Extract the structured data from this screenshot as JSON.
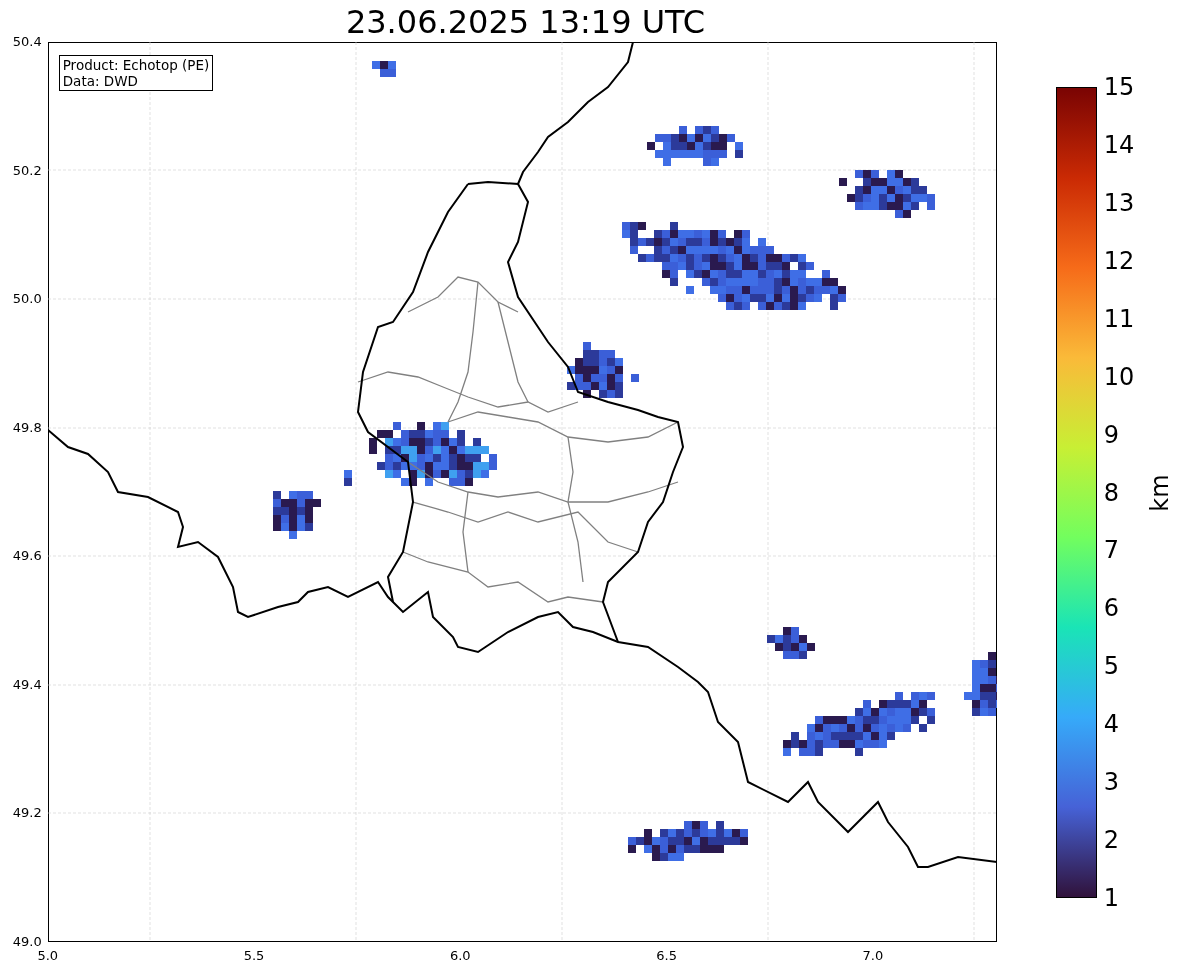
{
  "title": "23.06.2025 13:19 UTC",
  "legend": {
    "lines": [
      "Product: Echotop (PE)",
      "Data: DWD"
    ]
  },
  "x_axis": {
    "ticks": [
      "5.0",
      "5.5",
      "6.0",
      "6.5",
      "7.0"
    ]
  },
  "y_axis": {
    "ticks": [
      "50.4",
      "50.2",
      "50.0",
      "49.8",
      "49.6",
      "49.4",
      "49.2",
      "49.0"
    ]
  },
  "colorbar": {
    "label": "km",
    "ticks": [
      "15",
      "14",
      "13",
      "12",
      "11",
      "10",
      "9",
      "8",
      "7",
      "6",
      "5",
      "4",
      "3",
      "2",
      "1"
    ]
  }
}
